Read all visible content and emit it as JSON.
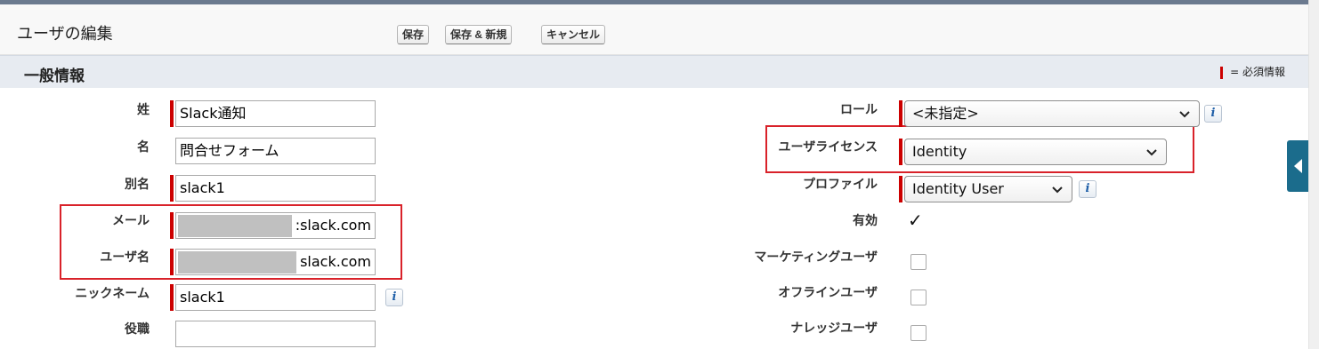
{
  "header": {
    "title": "ユーザの編集",
    "buttons": {
      "save": "保存",
      "save_new": "保存 & 新規",
      "cancel": "キャンセル"
    }
  },
  "section": {
    "title": "一般情報",
    "required_legend": "= 必須情報"
  },
  "left_fields": {
    "last_name": {
      "label": "姓",
      "value": "Slack通知"
    },
    "first_name": {
      "label": "名",
      "value": "問合せフォーム"
    },
    "alias": {
      "label": "別名",
      "value": "slack1"
    },
    "email": {
      "label": "メール",
      "value_visible": ":slack.com"
    },
    "username": {
      "label": "ユーザ名",
      "value_visible": "slack.com"
    },
    "nickname": {
      "label": "ニックネーム",
      "value": "slack1"
    },
    "title": {
      "label": "役職",
      "value": ""
    }
  },
  "right_fields": {
    "role": {
      "label": "ロール",
      "selected": "<未指定>"
    },
    "license": {
      "label": "ユーザライセンス",
      "selected": "Identity"
    },
    "profile": {
      "label": "プロファイル",
      "selected": "Identity User"
    },
    "active": {
      "label": "有効",
      "checked": true
    },
    "marketing_user": {
      "label": "マーケティングユーザ",
      "checked": false
    },
    "offline_user": {
      "label": "オフラインユーザ",
      "checked": false
    },
    "knowledge_user": {
      "label": "ナレッジユーザ",
      "checked": false
    }
  },
  "icons": {
    "info": "i",
    "check": "✓",
    "chevron": "chevron-down-icon",
    "side_tab": "triangle-left-icon"
  },
  "colors": {
    "required": "#cc0000",
    "highlight": "#d9222a",
    "side_tab": "#1b6c8c"
  }
}
